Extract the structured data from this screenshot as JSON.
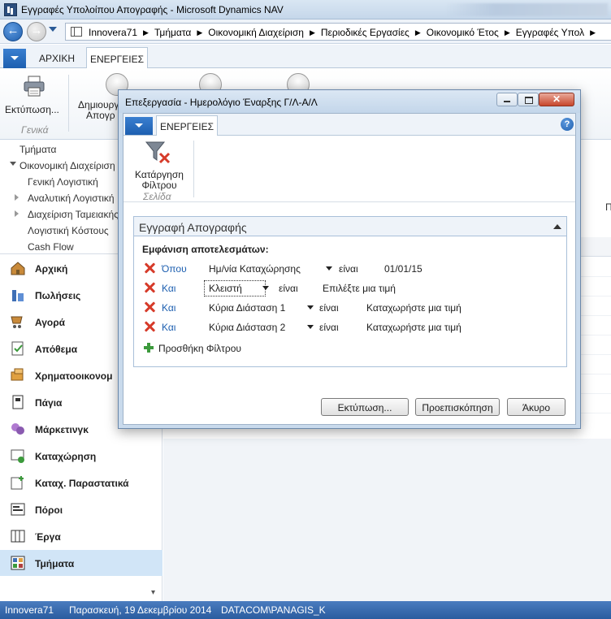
{
  "window": {
    "title": "Εγγραφές Υπολοίπου Απογραφής - Microsoft Dynamics NAV"
  },
  "breadcrumb": [
    "Innovera71",
    "Τμήματα",
    "Οικονομική Διαχείριση",
    "Περιοδικές Εργασίες",
    "Οικονομικό Έτος",
    "Εγγραφές Υπολ"
  ],
  "ribbon": {
    "tabs": [
      "ΑΡΧΙΚΗ",
      "ΕΝΕΡΓΕΙΕΣ"
    ],
    "print_label": "Εκτύπωση...",
    "create_label_1": "Δημιουργ",
    "create_label_2": "Απογρ",
    "group_general": "Γενικά"
  },
  "nav_tree": [
    {
      "label": "Τμήματα",
      "indent": 0,
      "arrow": "none"
    },
    {
      "label": "Οικονομική Διαχείριση",
      "indent": 0,
      "arrow": "down"
    },
    {
      "label": "Γενική Λογιστική",
      "indent": 1,
      "arrow": "none"
    },
    {
      "label": "Αναλυτική Λογιστική",
      "indent": 1,
      "arrow": "right"
    },
    {
      "label": "Διαχείριση Ταμειακής",
      "indent": 1,
      "arrow": "right"
    },
    {
      "label": "Λογιστική Κόστους",
      "indent": 1,
      "arrow": "none"
    },
    {
      "label": "Cash Flow",
      "indent": 1,
      "arrow": "none"
    }
  ],
  "nav_buttons": [
    {
      "label": "Αρχική",
      "icon": "home-icon"
    },
    {
      "label": "Πωλήσεις",
      "icon": "sales-icon"
    },
    {
      "label": "Αγορά",
      "icon": "purchase-icon"
    },
    {
      "label": "Απόθεμα",
      "icon": "inventory-icon"
    },
    {
      "label": "Χρηματοοικονομ",
      "icon": "finance-icon"
    },
    {
      "label": "Πάγια",
      "icon": "fixed-assets-icon"
    },
    {
      "label": "Μάρκετινγκ",
      "icon": "marketing-icon"
    },
    {
      "label": "Καταχώρηση",
      "icon": "posting-icon"
    },
    {
      "label": "Καταχ. Παραστατικά",
      "icon": "posted-documents-icon"
    },
    {
      "label": "Πόροι",
      "icon": "resources-icon"
    },
    {
      "label": "Έργα",
      "icon": "jobs-icon"
    },
    {
      "label": "Τμήματα",
      "icon": "departments-icon"
    }
  ],
  "content": {
    "side_letter": "Π"
  },
  "status": {
    "company": "Innovera71",
    "date": "Παρασκευή, 19 Δεκεμβρίου 2014",
    "user": "DATACOM\\PANAGIS_K"
  },
  "dialog": {
    "title": "Επεξεργασία - Ημερολόγιο Έναρξης Γ/Λ-Α/Λ",
    "tab_actions": "ΕΝΕΡΓΕΙΕΣ",
    "help": "?",
    "clear_filter_line1": "Κατάργηση",
    "clear_filter_line2": "Φίλτρου",
    "group_page": "Σελίδα",
    "fasttab_title": "Εγγραφή Απογραφής",
    "show_results": "Εμφάνιση αποτελεσμάτων:",
    "filters": [
      {
        "conj": "Όπου",
        "field": "Ημ/νία Καταχώρησης",
        "op": "είναι",
        "value": "01/01/15"
      },
      {
        "conj": "Και",
        "field": "Κλειστή",
        "op": "είναι",
        "value": "Επιλέξτε μια τιμή"
      },
      {
        "conj": "Και",
        "field": "Κύρια Διάσταση 1",
        "op": "είναι",
        "value": "Καταχωρήστε μια τιμή"
      },
      {
        "conj": "Και",
        "field": "Κύρια Διάσταση 2",
        "op": "είναι",
        "value": "Καταχωρήστε μια τιμή"
      }
    ],
    "add_filter": "Προσθήκη Φίλτρου",
    "buttons": {
      "print": "Εκτύπωση...",
      "preview": "Προεπισκόπηση",
      "cancel": "Άκυρο"
    }
  }
}
